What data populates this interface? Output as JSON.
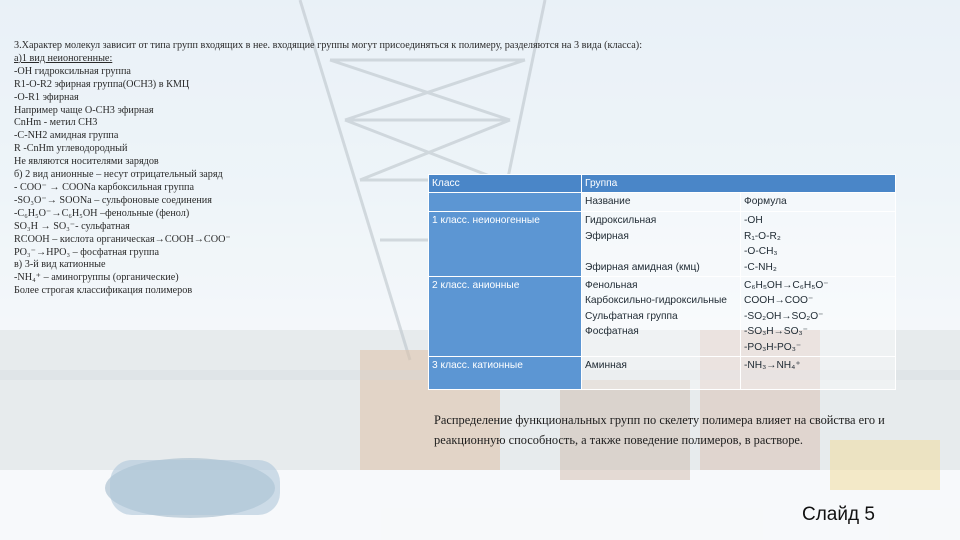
{
  "left_text": {
    "lines": [
      "3.Характер молекул зависит от типа групп входящих в нее. входящие группы могут присоединяться к полимеру, разделяются на 3 вида (класса):",
      "а)1 вид неионогенные:",
      " -OH гидроксильная группа",
      "R1-O-R2 эфирная группа(OCH3) в КМЦ",
      "-O-R1 эфирная",
      "Например чаще O-CH3 эфирная",
      "CnHm - метил CH3",
      "-C-NH2 амидная группа",
      "R -CnHm углеводородный",
      "Не являются носителями зарядов",
      "б) 2 вид анионные – несут отрицательный заряд",
      "- COO⁻ → COONa карбоксильная группа",
      "-SO₃O⁻→ SOONa – сульфоновые соединения",
      "-C₆H₅O⁻→C₆H₅OH –фенольные (фенол)",
      "SO₃H → SO₃⁻- сульфатная",
      "RCOOH – кислота органическая→COOH→COO⁻",
      "PO₃⁻→HPO₃ – фосфатная группа",
      "в) 3-й вид катионные",
      "-NH₄⁺ – аминогруппы (органические)",
      "Более строгая классификация полимеров"
    ]
  },
  "table": {
    "header": [
      "Класс",
      "Группа",
      ""
    ],
    "subheader": [
      "",
      "Название",
      "Формула"
    ],
    "rows": [
      {
        "class": "1 класс. неионогенные",
        "names": [
          "Гидроксильная",
          "Эфирная",
          "",
          "Эфирная амидная (кмц)"
        ],
        "formulas": [
          "-OH",
          "R₁-O-R₂",
          "-O-CH₃",
          "-C-NH₂"
        ]
      },
      {
        "class": "2 класс. анионные",
        "names": [
          "Фенольная",
          "Карбоксильно-гидроксильные",
          "Сульфатная группа",
          "Фосфатная"
        ],
        "formulas": [
          "C₆H₅OH→C₆H₅O⁻",
          "COOH→COO⁻",
          "-SO₂OH→SO₂O⁻",
          "-SO₃H→SO₃⁻",
          "-PO₃H-PO₃⁻"
        ]
      },
      {
        "class": "3 класс. катионные",
        "names": [
          "Аминная"
        ],
        "formulas": [
          "-NH₃→NH₄⁺"
        ]
      }
    ]
  },
  "note": "Распределение функциональных групп по скелету полимера влияет на свойства его и реакционную способность, а также поведение полимеров, в растворе.",
  "slide_label": "Слайд 5"
}
